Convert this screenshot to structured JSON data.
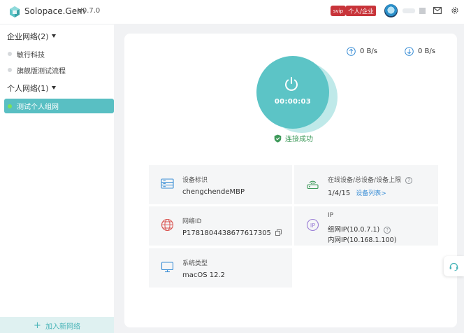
{
  "app": {
    "name": "Solopace.Gem",
    "version": "V0.7.0"
  },
  "header": {
    "vip_label": "svip",
    "plan_label": "个人/企业"
  },
  "sidebar": {
    "groups": [
      {
        "title": "企业网络(2)",
        "items": [
          {
            "label": "敏行科技"
          },
          {
            "label": "旗舰版测试流程"
          }
        ]
      },
      {
        "title": "个人网络(1)",
        "items": [
          {
            "label": "测试个人组网",
            "active": true
          }
        ]
      }
    ],
    "add_network_label": "加入新网络"
  },
  "traffic": {
    "upload": "0 B/s",
    "download": "0 B/s"
  },
  "connection": {
    "timer": "00:00:03",
    "status": "连接成功"
  },
  "device_info": {
    "device_id": {
      "label": "设备标识",
      "value": "chengchendeMBP"
    },
    "online": {
      "label": "在线设备/总设备/设备上限",
      "value": "1/4/15",
      "link": "设备列表>"
    },
    "network_id": {
      "label": "网络ID",
      "value": "P1781804438677617305"
    },
    "ip": {
      "label": "IP",
      "group_ip": "组网IP(10.0.7.1)",
      "lan_ip": "内网IP(10.168.1.100)"
    },
    "os": {
      "label": "系统类型",
      "value": "macOS 12.2"
    }
  },
  "colors": {
    "accent": "#59bfc3",
    "success": "#3f9a5b",
    "badge": "#c8343a",
    "link": "#3c8fd6"
  }
}
